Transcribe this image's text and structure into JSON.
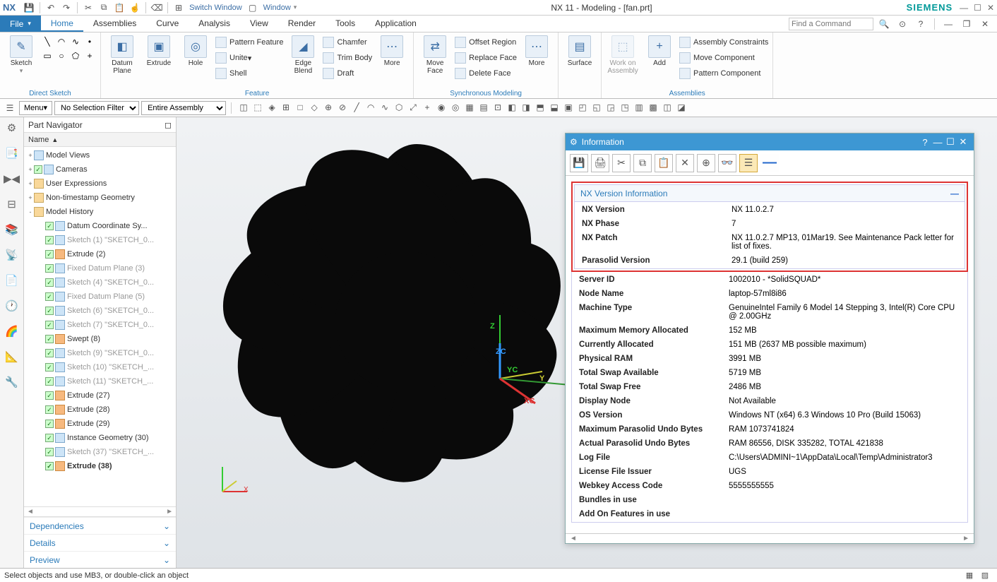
{
  "title": "NX 11 - Modeling - [fan.prt]",
  "brand": "SIEMENS",
  "switch_window": "Switch Window",
  "window_menu": "Window",
  "file_menu": "File",
  "menus": [
    "Home",
    "Assemblies",
    "Curve",
    "Analysis",
    "View",
    "Render",
    "Tools",
    "Application"
  ],
  "find_placeholder": "Find a Command",
  "ribbon": {
    "sketch": "Sketch",
    "direct_sketch": "Direct Sketch",
    "datum_plane": "Datum\nPlane",
    "extrude": "Extrude",
    "hole": "Hole",
    "pattern": "Pattern Feature",
    "unite": "Unite",
    "shell": "Shell",
    "feature": "Feature",
    "edge_blend": "Edge\nBlend",
    "chamfer": "Chamfer",
    "trim": "Trim Body",
    "draft": "Draft",
    "more1": "More",
    "move_face": "Move\nFace",
    "offset_region": "Offset Region",
    "replace_face": "Replace Face",
    "delete_face": "Delete Face",
    "sync": "Synchronous Modeling",
    "more2": "More",
    "surface": "Surface",
    "work_on": "Work on\nAssembly",
    "add": "Add",
    "asm_constraints": "Assembly Constraints",
    "move_comp": "Move Component",
    "pattern_comp": "Pattern Component",
    "assemblies": "Assemblies"
  },
  "toolrow": {
    "menu": "Menu",
    "filter1": "No Selection Filter",
    "filter2": "Entire Assembly"
  },
  "nav": {
    "title": "Part Navigator",
    "col": "Name",
    "tree": [
      {
        "exp": "+",
        "lbl": "Model Views",
        "lvl": 0,
        "chk": false,
        "icon": "blue"
      },
      {
        "exp": "+",
        "lbl": "Cameras",
        "lvl": 0,
        "chk": true,
        "icon": "blue"
      },
      {
        "exp": "+",
        "lbl": "User Expressions",
        "lvl": 0,
        "chk": false,
        "icon": ""
      },
      {
        "exp": "+",
        "lbl": "Non-timestamp Geometry",
        "lvl": 0,
        "chk": false,
        "icon": ""
      },
      {
        "exp": "-",
        "lbl": "Model History",
        "lvl": 0,
        "chk": false,
        "icon": ""
      },
      {
        "exp": "",
        "lbl": "Datum Coordinate Sy...",
        "lvl": 1,
        "chk": true,
        "icon": "blue"
      },
      {
        "exp": "",
        "lbl": "Sketch (1) \"SKETCH_0...",
        "lvl": 1,
        "chk": true,
        "icon": "blue",
        "dim": true
      },
      {
        "exp": "",
        "lbl": "Extrude (2)",
        "lvl": 1,
        "chk": true,
        "icon": "orange"
      },
      {
        "exp": "",
        "lbl": "Fixed Datum Plane (3)",
        "lvl": 1,
        "chk": true,
        "icon": "blue",
        "dim": true
      },
      {
        "exp": "",
        "lbl": "Sketch (4) \"SKETCH_0...",
        "lvl": 1,
        "chk": true,
        "icon": "blue",
        "dim": true
      },
      {
        "exp": "",
        "lbl": "Fixed Datum Plane (5)",
        "lvl": 1,
        "chk": true,
        "icon": "blue",
        "dim": true
      },
      {
        "exp": "",
        "lbl": "Sketch (6) \"SKETCH_0...",
        "lvl": 1,
        "chk": true,
        "icon": "blue",
        "dim": true
      },
      {
        "exp": "",
        "lbl": "Sketch (7) \"SKETCH_0...",
        "lvl": 1,
        "chk": true,
        "icon": "blue",
        "dim": true
      },
      {
        "exp": "",
        "lbl": "Swept (8)",
        "lvl": 1,
        "chk": true,
        "icon": "orange"
      },
      {
        "exp": "",
        "lbl": "Sketch (9) \"SKETCH_0...",
        "lvl": 1,
        "chk": true,
        "icon": "blue",
        "dim": true
      },
      {
        "exp": "",
        "lbl": "Sketch (10) \"SKETCH_...",
        "lvl": 1,
        "chk": true,
        "icon": "blue",
        "dim": true
      },
      {
        "exp": "",
        "lbl": "Sketch (11) \"SKETCH_...",
        "lvl": 1,
        "chk": true,
        "icon": "blue",
        "dim": true
      },
      {
        "exp": "",
        "lbl": "Extrude (27)",
        "lvl": 1,
        "chk": true,
        "icon": "orange"
      },
      {
        "exp": "",
        "lbl": "Extrude (28)",
        "lvl": 1,
        "chk": true,
        "icon": "orange"
      },
      {
        "exp": "",
        "lbl": "Extrude (29)",
        "lvl": 1,
        "chk": true,
        "icon": "orange"
      },
      {
        "exp": "",
        "lbl": "Instance Geometry (30)",
        "lvl": 1,
        "chk": true,
        "icon": "blue"
      },
      {
        "exp": "",
        "lbl": "Sketch (37) \"SKETCH_...",
        "lvl": 1,
        "chk": true,
        "icon": "blue",
        "dim": true
      },
      {
        "exp": "",
        "lbl": "Extrude (38)",
        "lvl": 1,
        "chk": true,
        "icon": "orange",
        "bold": true
      }
    ],
    "dependencies": "Dependencies",
    "details": "Details",
    "preview": "Preview"
  },
  "info": {
    "title": "Information",
    "section": "NX Version Information",
    "rows": [
      [
        "NX Version",
        "NX 11.0.2.7"
      ],
      [
        "NX Phase",
        "7"
      ],
      [
        "NX Patch",
        "NX 11.0.2.7 MP13, 01Mar19. See Maintenance Pack letter for list of fixes."
      ],
      [
        "Parasolid Version",
        "29.1 (build 259)"
      ],
      [
        "Server ID",
        "1002010 - *SolidSQUAD*"
      ],
      [
        "Node Name",
        "laptop-57ml8i86"
      ],
      [
        "Machine Type",
        "GenuineIntel Family 6 Model 14 Stepping 3, Intel(R) Core CPU @ 2.00GHz"
      ],
      [
        "Maximum Memory Allocated",
        "152 MB"
      ],
      [
        "Currently Allocated",
        "151 MB (2637 MB possible maximum)"
      ],
      [
        "Physical RAM",
        "3991 MB"
      ],
      [
        "Total Swap Available",
        "5719 MB"
      ],
      [
        "Total Swap Free",
        "2486 MB"
      ],
      [
        "Display Node",
        "Not Available"
      ],
      [
        "OS Version",
        "Windows NT (x64) 6.3 Windows 10 Pro (Build 15063)"
      ],
      [
        "Maximum Parasolid Undo Bytes",
        "RAM 1073741824"
      ],
      [
        "Actual Parasolid Undo Bytes",
        "RAM 86556, DISK 335282, TOTAL 421838"
      ],
      [
        "Log File",
        "C:\\Users\\ADMINI~1\\AppData\\Local\\Temp\\Administrator3"
      ],
      [
        "License File Issuer",
        "UGS"
      ],
      [
        "Webkey Access Code",
        "5555555555"
      ],
      [
        "Bundles in use",
        ""
      ],
      [
        "Add On Features in use",
        ""
      ]
    ]
  },
  "status": "Select objects and use MB3, or double-click an object",
  "axes": {
    "x": "X",
    "y": "Y",
    "z": "Z",
    "xc": "XC",
    "yc": "YC",
    "zc": "ZC"
  }
}
